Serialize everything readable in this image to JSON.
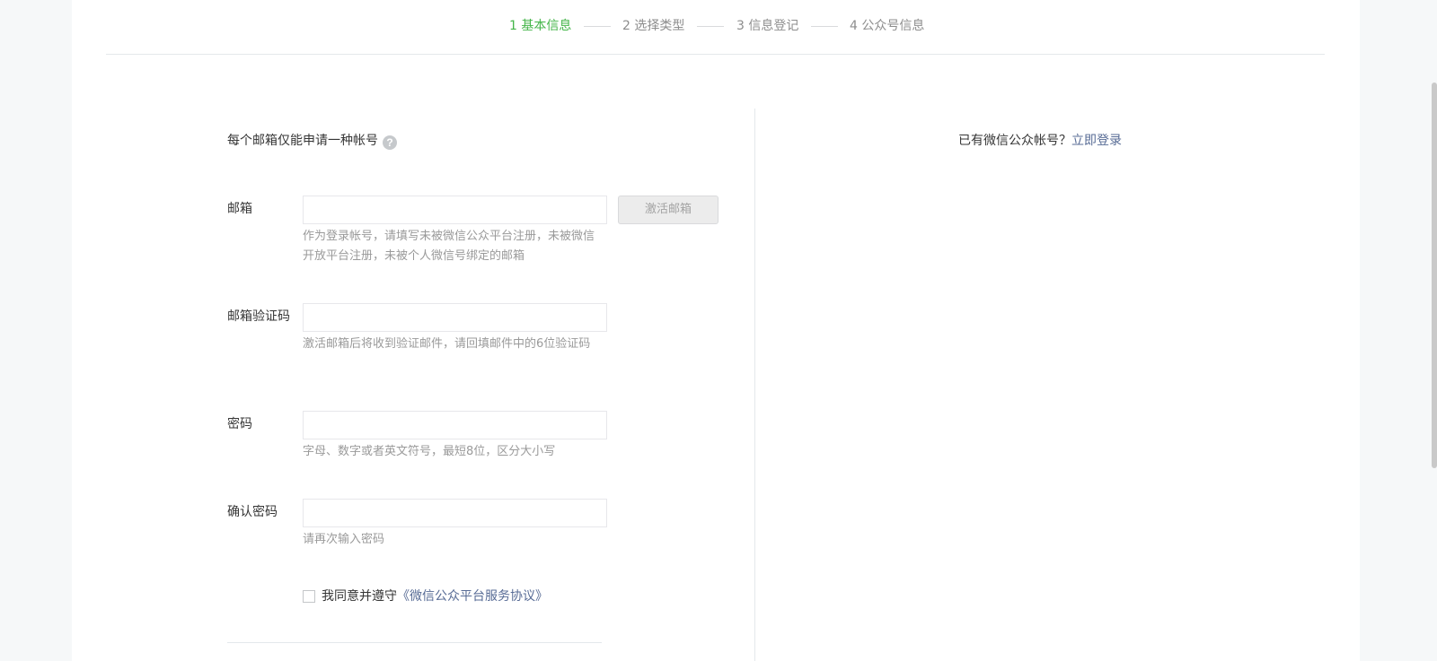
{
  "steps": [
    {
      "label": "1 基本信息",
      "active": true
    },
    {
      "label": "2 选择类型",
      "active": false
    },
    {
      "label": "3 信息登记",
      "active": false
    },
    {
      "label": "4 公众号信息",
      "active": false
    }
  ],
  "form": {
    "notice": "每个邮箱仅能申请一种帐号",
    "email": {
      "label": "邮箱",
      "value": "",
      "tip": "作为登录帐号，请填写未被微信公众平台注册，未被微信开放平台注册，未被个人微信号绑定的邮箱",
      "activate_button": "激活邮箱"
    },
    "code": {
      "label": "邮箱验证码",
      "value": "",
      "tip": "激活邮箱后将收到验证邮件，请回填邮件中的6位验证码"
    },
    "password": {
      "label": "密码",
      "value": "",
      "tip": "字母、数字或者英文符号，最短8位，区分大小写"
    },
    "confirm": {
      "label": "确认密码",
      "value": "",
      "tip": "请再次输入密码"
    },
    "agree": {
      "text": "我同意并遵守",
      "link": "《微信公众平台服务协议》",
      "checked": false
    }
  },
  "aside": {
    "text": "已有微信公众帐号？",
    "link": "立即登录"
  },
  "colors": {
    "accent": "#44b549",
    "link": "#576b95",
    "muted": "#9a9a9a"
  }
}
